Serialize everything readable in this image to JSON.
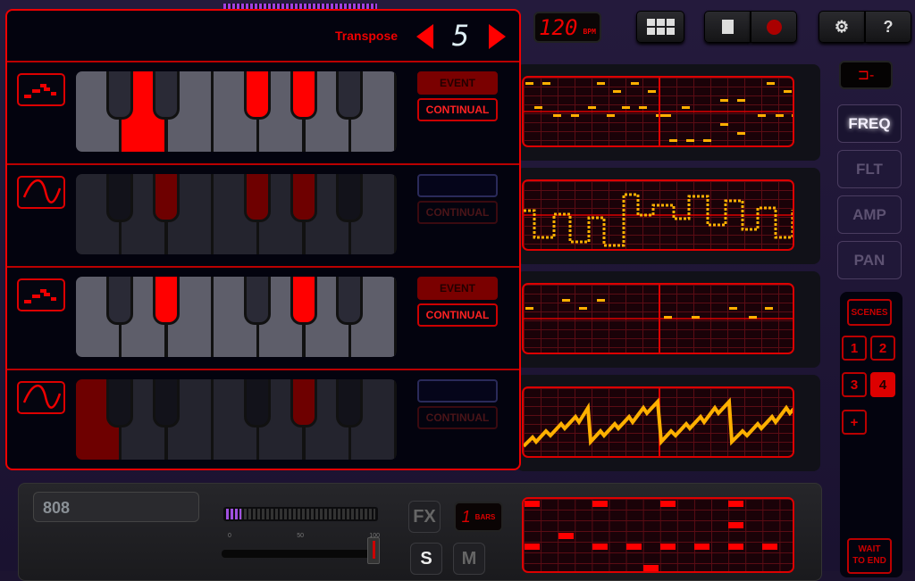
{
  "topbar": {
    "tempo": "120",
    "tempo_unit": "BPM",
    "help_label": "?"
  },
  "transpose": {
    "label": "Transpose",
    "value": "5"
  },
  "rows": [
    {
      "mode_icon": "notes-icon",
      "active": true,
      "event_label": "EVENT",
      "continual_label": "CONTINUAL",
      "selected": "event",
      "keys_on": [
        "D",
        "F#",
        "G#"
      ]
    },
    {
      "mode_icon": "sine-wave-icon",
      "active": false,
      "event_label": "",
      "continual_label": "CONTINUAL",
      "selected": "none",
      "keys_on": [
        "D#",
        "F#",
        "G#"
      ]
    },
    {
      "mode_icon": "notes-icon",
      "active": true,
      "event_label": "EVENT",
      "continual_label": "CONTINUAL",
      "selected": "event",
      "keys_on": [
        "D#",
        "G#"
      ]
    },
    {
      "mode_icon": "sine-wave-icon",
      "active": false,
      "event_label": "",
      "continual_label": "CONTINUAL",
      "selected": "none",
      "keys_on": [
        "C",
        "G#"
      ]
    }
  ],
  "side_tabs": [
    {
      "label": "FREQ",
      "active": true
    },
    {
      "label": "FLT",
      "active": false
    },
    {
      "label": "AMP",
      "active": false
    },
    {
      "label": "PAN",
      "active": false
    }
  ],
  "scenes": {
    "label": "SCENES",
    "items": [
      "1",
      "2",
      "3",
      "4"
    ],
    "selected": "4",
    "add_label": "+",
    "wait_label_1": "WAIT",
    "wait_label_2": "TO END"
  },
  "track": {
    "name": "808",
    "fx_label": "FX",
    "bars_value": "1",
    "bars_label": "BARS",
    "solo_label": "S",
    "mute_label": "M",
    "volume": 100,
    "scale": [
      "0",
      "50",
      "100"
    ],
    "level_meter": 0.1
  },
  "colors": {
    "accent": "#ff0000",
    "dim": "#6e0000",
    "amber": "#ffb000"
  }
}
